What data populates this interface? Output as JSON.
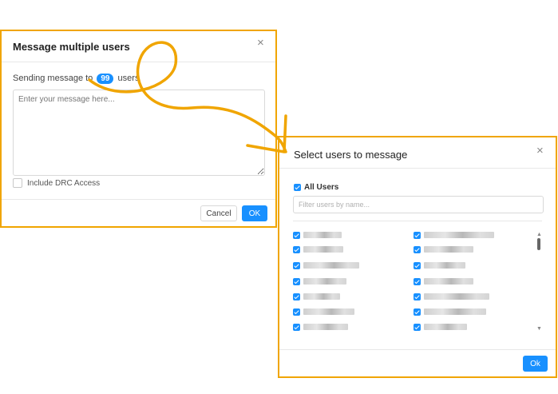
{
  "message_dialog": {
    "title": "Message multiple users",
    "close": "×",
    "sending_prefix": "Sending message to",
    "user_count": "99",
    "sending_suffix": "users",
    "textarea_placeholder": "Enter your message here...",
    "include_drc_label": "Include DRC Access",
    "cancel_label": "Cancel",
    "ok_label": "OK"
  },
  "select_dialog": {
    "title": "Select users to message",
    "close": "×",
    "all_users_label": "All Users",
    "filter_placeholder": "Filter users by name...",
    "ok_label": "Ok",
    "users_checked": [
      true,
      true,
      true,
      true,
      true,
      true,
      true,
      true,
      true,
      true,
      true,
      true,
      true,
      true
    ]
  },
  "colors": {
    "accent": "#1890ff",
    "annotation": "#f0a500"
  },
  "icons": {
    "close": "close-icon",
    "checkbox": "checkbox-icon",
    "scroll_up": "scroll-up-icon",
    "scroll_down": "scroll-down-icon"
  }
}
